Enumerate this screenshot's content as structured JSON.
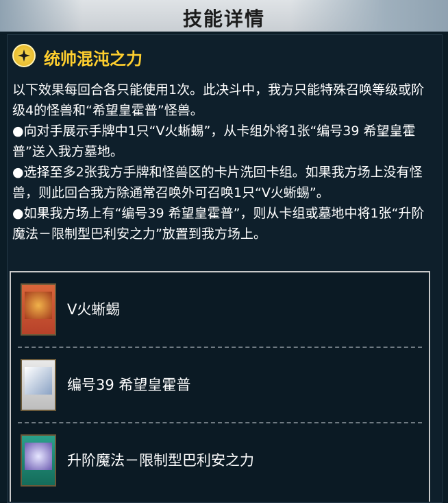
{
  "header": {
    "title": "技能详情"
  },
  "skill": {
    "name": "统帅混沌之力",
    "icon": "star-icon",
    "accent_color": "#ffcf2e"
  },
  "description": {
    "lines": [
      "以下效果每回合各只能使用1次。此决斗中，我方只能特殊召唤等级或阶级4的怪兽和“希望皇霍普”怪兽。",
      "●向对手展示手牌中1只“V火蜥蜴”，从卡组外将1张“编号39 希望皇霍普”送入我方墓地。",
      "●选择至多2张我方手牌和怪兽区的卡片洗回卡组。如果我方场上没有怪兽，则此回合我方除通常召唤外可召唤1只“V火蜥蜴”。",
      "●如果我方场上有“编号39 希望皇霍普”，则从卡组或墓地中将1张“升阶魔法－限制型巴利安之力”放置到我方场上。"
    ]
  },
  "cards": [
    {
      "name": "V火蜥蜴",
      "frame_color": "#c8552b"
    },
    {
      "name": "编号39 希望皇霍普",
      "frame_color": "#e8e8e8"
    },
    {
      "name": "升阶魔法－限制型巴利安之力",
      "frame_color": "#1e8a74"
    }
  ]
}
